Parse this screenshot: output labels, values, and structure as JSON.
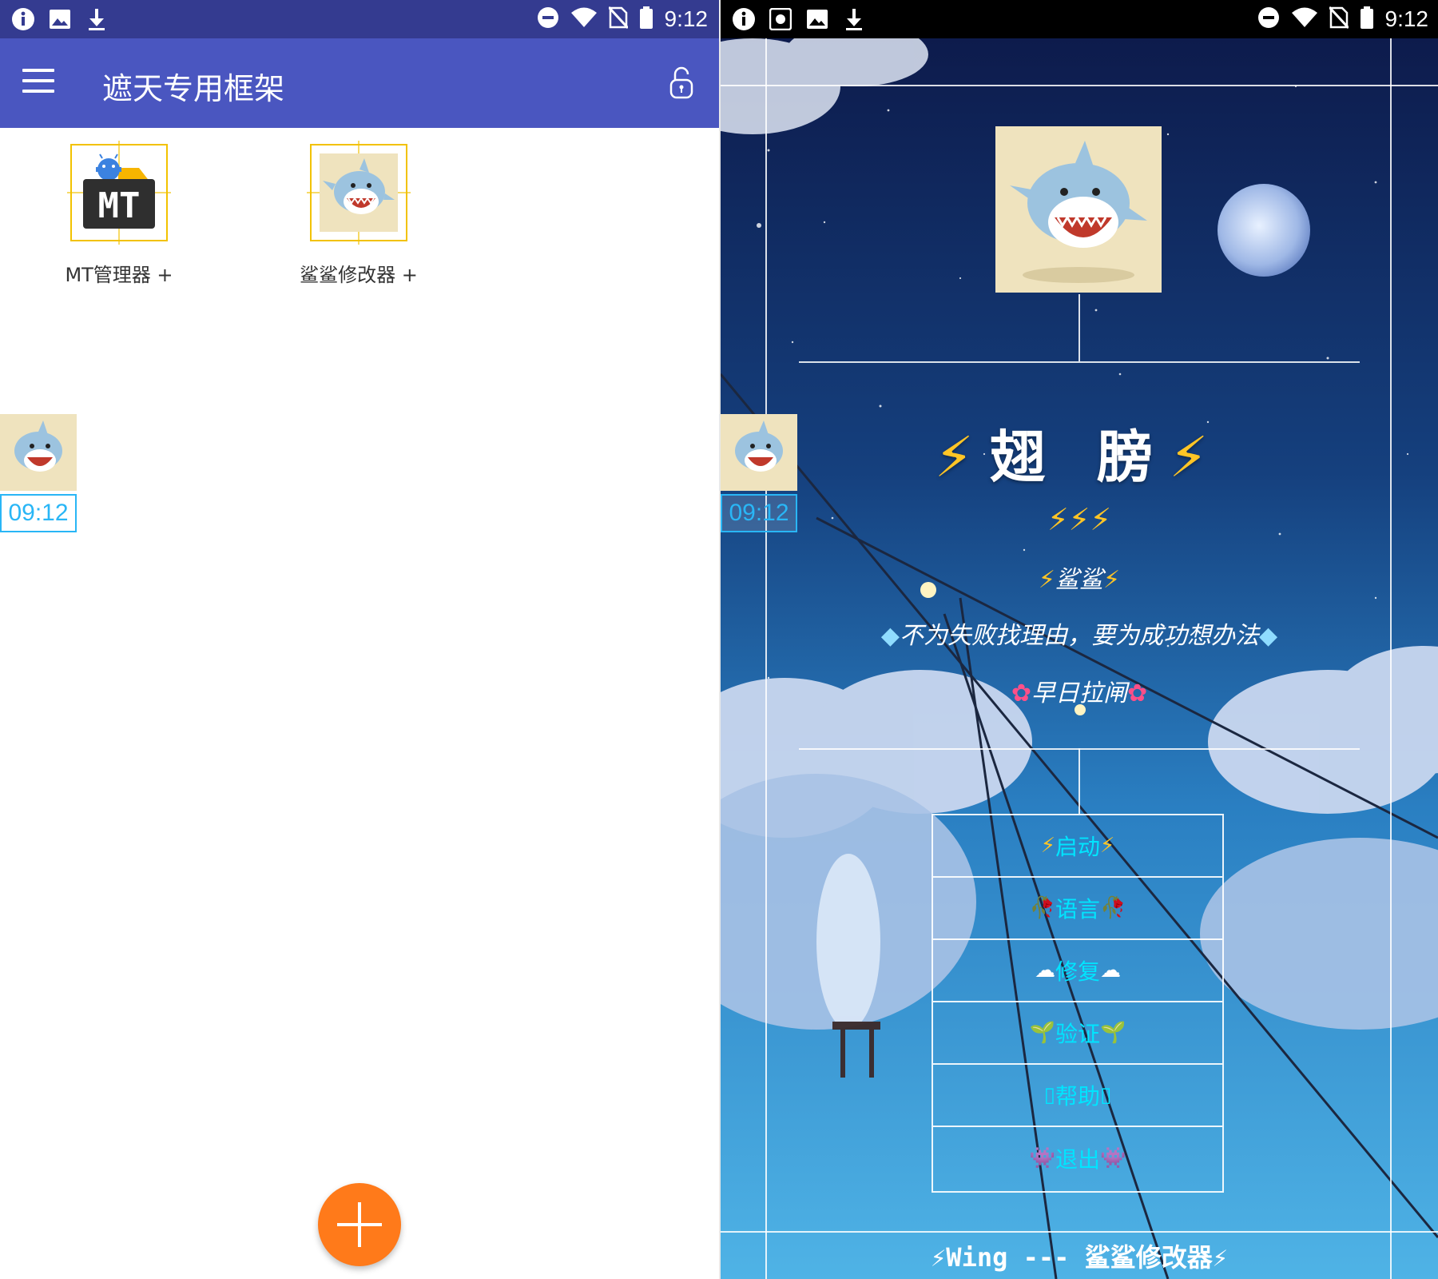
{
  "status_bar": {
    "time": "9:12"
  },
  "left": {
    "toolbar": {
      "title": "遮天专用框架"
    },
    "apps": [
      {
        "label": "MT管理器 +",
        "icon": "mt-manager-icon"
      },
      {
        "label": "鲨鲨修改器 +",
        "icon": "shark-icon"
      }
    ],
    "floating_clock": "09:12",
    "colors": {
      "toolbar": "#4a56c0",
      "statusbar": "#343b90",
      "fab": "#ff7a1a",
      "accent": "#29b6f6"
    }
  },
  "right": {
    "title": "翅 膀",
    "title_bolt": "⚡",
    "bolts": "⚡⚡⚡",
    "name": "鲨鲨",
    "motto": "不为失败找理由，要为成功想办法",
    "cheer": "早日拉闸",
    "floating_clock": "09:12",
    "menu": [
      {
        "label": "启动",
        "deco": "⚡"
      },
      {
        "label": "语言",
        "deco": "🥀"
      },
      {
        "label": "修复",
        "deco": "☁"
      },
      {
        "label": "验证",
        "deco": "🌱"
      },
      {
        "label": "帮助",
        "deco": "▯"
      },
      {
        "label": "退出",
        "deco": "👾"
      }
    ],
    "footer": "⚡Wing --- 鲨鲨修改器⚡",
    "colors": {
      "menu_text": "#00e5ff",
      "bolt": "#ffc526"
    }
  }
}
